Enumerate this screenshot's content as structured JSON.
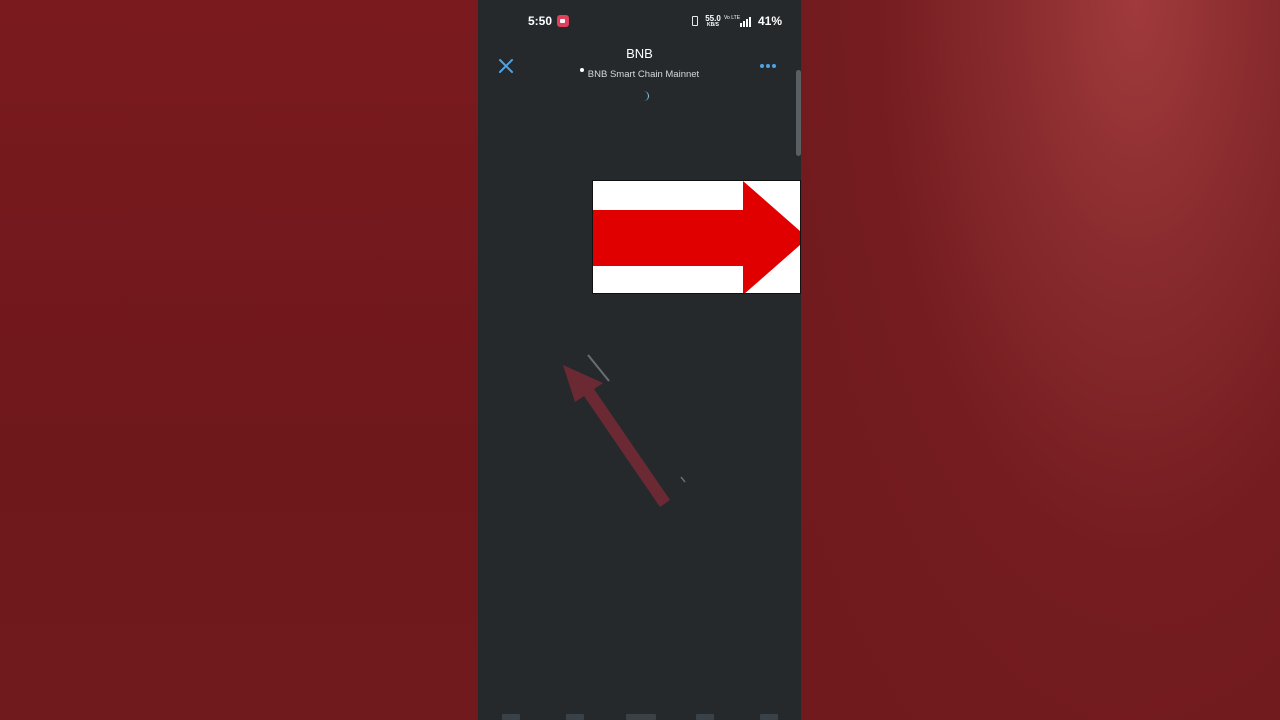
{
  "status_bar": {
    "time": "5:50",
    "net_speed_value": "55.0",
    "net_speed_unit": "KB/S",
    "network_type": "Vo LTE",
    "signal_label": "5G",
    "battery": "41%"
  },
  "header": {
    "title": "BNB",
    "network": "BNB Smart Chain Mainnet"
  },
  "colors": {
    "accent_blue": "#4da3e6",
    "arrow_red": "#e00000",
    "overlay_arrow": "#6b2a33"
  },
  "icons": {
    "close": "close-icon",
    "more": "more-icon",
    "recording": "screen-record-icon"
  }
}
